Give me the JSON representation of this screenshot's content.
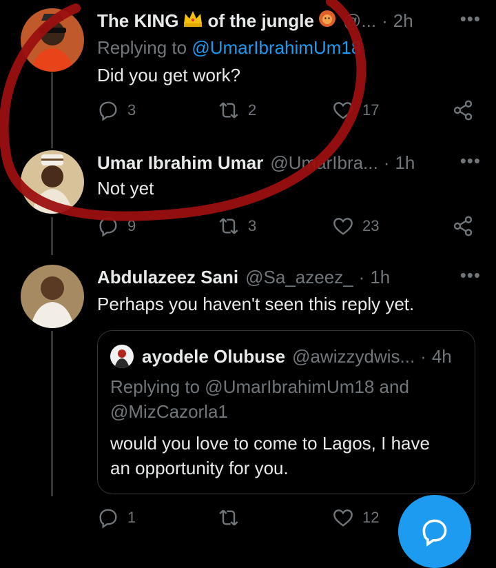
{
  "tweets": [
    {
      "name": "The KING",
      "name_suffix": "of the jungle",
      "handle": "@...",
      "time": "2h",
      "replying_prefix": "Replying to",
      "replying_to": "@UmarIbrahimUm18",
      "text": "Did you get work?",
      "replies": "3",
      "retweets": "2",
      "likes": "17"
    },
    {
      "name": "Umar Ibrahim Umar",
      "handle": "@UmarIbra...",
      "time": "1h",
      "text": "Not yet",
      "replies": "9",
      "retweets": "3",
      "likes": "23"
    },
    {
      "name": "Abdulazeez Sani",
      "handle": "@Sa_azeez_",
      "time": "1h",
      "text": "Perhaps you haven't seen this reply yet.",
      "replies": "1",
      "retweets": "",
      "likes": "12",
      "quote": {
        "name": "ayodele Olubuse",
        "handle": "@awizzydwis...",
        "time": "4h",
        "replying_line1": "Replying to @UmarIbrahimUm18 and",
        "replying_line2": "@MizCazorla1",
        "text_line1": "would you love to come to Lagos, I have",
        "text_line2": "an opportunity for you."
      }
    }
  ],
  "dot": "·",
  "more": "•••",
  "icons": {
    "reply": "reply-icon",
    "retweet": "retweet-icon",
    "like": "heart-icon",
    "share": "share-icon",
    "compose": "compose-icon",
    "crown": "crown-emoji",
    "lion": "lion-emoji"
  },
  "colors": {
    "background": "#000000",
    "primary_text": "#e7e9ea",
    "secondary_text": "#71767b",
    "link": "#1d9bf0",
    "like_highlight": "#f91880",
    "annotation": "#9b1010"
  }
}
